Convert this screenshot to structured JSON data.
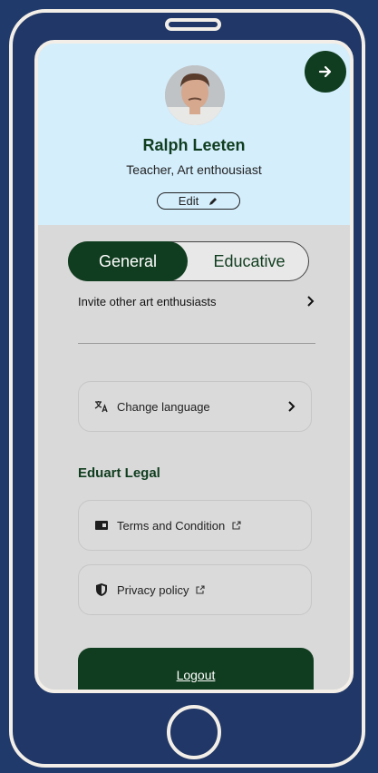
{
  "profile": {
    "name": "Ralph Leeten",
    "subtitle": "Teacher, Art enthousiast",
    "edit_label": "Edit"
  },
  "tabs": [
    {
      "label": "General",
      "active": true
    },
    {
      "label": "Educative",
      "active": false
    }
  ],
  "invite": {
    "label": "Invite other art enthusiasts"
  },
  "language": {
    "label": "Change language"
  },
  "legal": {
    "title": "Eduart Legal",
    "terms_label": "Terms and Condition",
    "privacy_label": "Privacy policy"
  },
  "logout_label": "Logout",
  "colors": {
    "frame_bg": "#213a6c",
    "frame_border": "#f3efe8",
    "header_bg": "#d4eefc",
    "body_bg": "#d9d9d9",
    "accent": "#103d1f"
  },
  "icons": {
    "next": "arrow-right-icon",
    "edit": "pencil-icon",
    "language": "translate-icon",
    "terms": "document-icon",
    "privacy": "shield-icon",
    "external": "external-link-icon",
    "chevron": "chevron-right-icon"
  }
}
